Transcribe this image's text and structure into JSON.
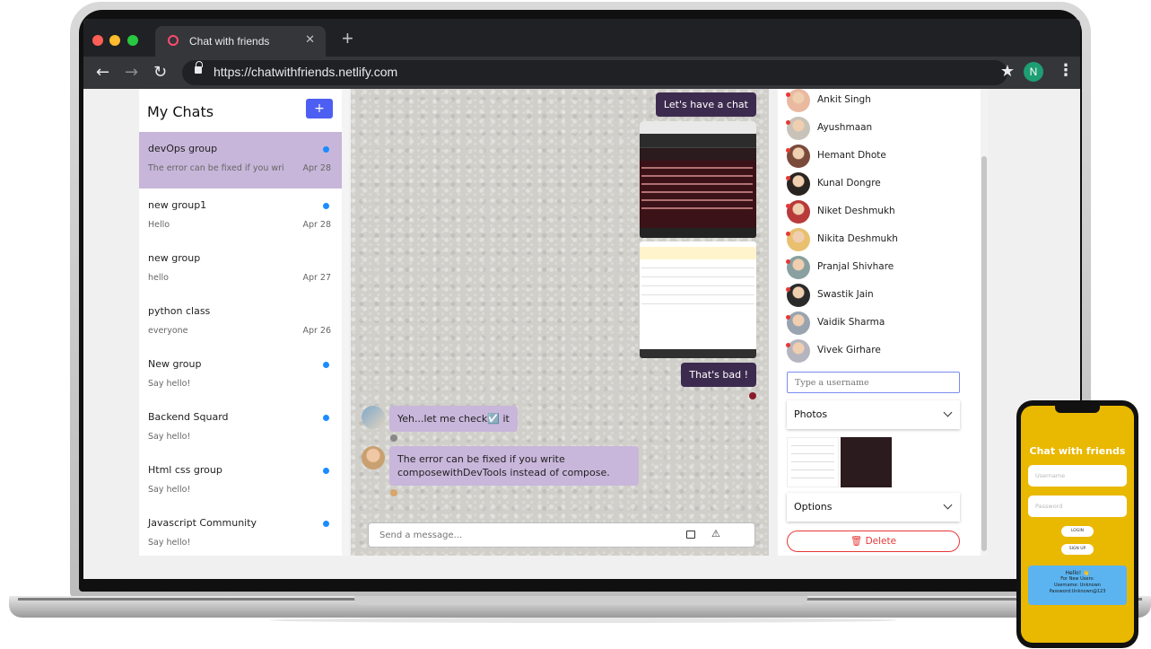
{
  "browser": {
    "tab_title": "Chat with friends",
    "tab_close": "✕",
    "new_tab": "+",
    "url": "https://chatwithfriends.netlify.com",
    "profile_initial": "N"
  },
  "chats_panel": {
    "title": "My Chats",
    "add_label": "+",
    "items": [
      {
        "name": "devOps group",
        "preview": "The error can be fixed if you wri",
        "date": "Apr 28",
        "unread": true,
        "active": true
      },
      {
        "name": "new group1",
        "preview": "Hello",
        "date": "Apr 28",
        "unread": true,
        "active": false
      },
      {
        "name": "new group",
        "preview": "hello",
        "date": "Apr 27",
        "unread": false,
        "active": false
      },
      {
        "name": "python class",
        "preview": "everyone",
        "date": "Apr 26",
        "unread": false,
        "active": false
      },
      {
        "name": "New group",
        "preview": "Say hello!",
        "date": "",
        "unread": true,
        "active": false
      },
      {
        "name": "Backend Squard",
        "preview": "Say hello!",
        "date": "",
        "unread": true,
        "active": false
      },
      {
        "name": "Html css group",
        "preview": "Say hello!",
        "date": "",
        "unread": true,
        "active": false
      },
      {
        "name": "Javascript Community",
        "preview": "Say hello!",
        "date": "",
        "unread": true,
        "active": false
      }
    ]
  },
  "conversation": {
    "messages": [
      {
        "side": "right",
        "text": "Let's have a chat"
      },
      {
        "side": "right",
        "text": "That's bad !"
      },
      {
        "side": "left",
        "text": "Yeh...let me check☑️ it"
      },
      {
        "side": "left",
        "text": "The error can be fixed if you write composewithDevTools instead of compose."
      }
    ],
    "composer_placeholder": "Send a message..."
  },
  "members_panel": {
    "members": [
      "Ankit Singh",
      "Ayushmaan",
      "Hemant Dhote",
      "Kunal Dongre",
      "Niket Deshmukh",
      "Nikita Deshmukh",
      "Pranjal Shivhare",
      "Swastik Jain",
      "Vaidik Sharma",
      "Vivek Girhare"
    ],
    "username_placeholder": "Type a username",
    "photos_label": "Photos",
    "options_label": "Options",
    "delete_label": "🗑 Delete"
  },
  "phone": {
    "title": "Chat with friends",
    "username_placeholder": "Username",
    "password_placeholder": "Password",
    "login_label": "LOGIN",
    "signup_label": "SIGN UP",
    "card_hello": "Hello! 👋",
    "card_line1": "For New Users:",
    "card_line2": "Username: Unknown",
    "card_line3": "Password:Unknown@123"
  },
  "colors": {
    "active_chat": "#c8b6da",
    "my_bubble": "#3d2b4f",
    "their_bubble": "#c9b6db",
    "add_button": "#4d5ff2",
    "unread_dot": "#1a8cff",
    "delete": "#e53935",
    "phone_bg": "#e9b800"
  }
}
